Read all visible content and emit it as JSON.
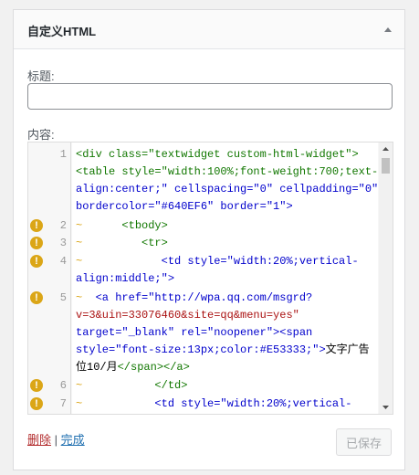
{
  "widget": {
    "title": "自定义HTML",
    "toggle_icon": "arrow-up-icon"
  },
  "form": {
    "title_label": "标题:",
    "title_value": "",
    "content_label": "内容:"
  },
  "editor": {
    "lines": [
      {
        "num": "1",
        "warn": false
      },
      {
        "num": "",
        "warn": false
      },
      {
        "num": "",
        "warn": false
      },
      {
        "num": "2",
        "warn": true
      },
      {
        "num": "3",
        "warn": true
      },
      {
        "num": "4",
        "warn": true
      },
      {
        "num": "",
        "warn": false
      },
      {
        "num": "5",
        "warn": true
      },
      {
        "num": "",
        "warn": false
      },
      {
        "num": "",
        "warn": false
      },
      {
        "num": "",
        "warn": false
      },
      {
        "num": "",
        "warn": false
      },
      {
        "num": "6",
        "warn": true
      },
      {
        "num": "7",
        "warn": true
      }
    ],
    "code": {
      "l1": "<div class=\"textwidget custom-html-widget\">",
      "l2": "<table style=\"width:100%;font-weight:700;text-",
      "l3": "align:center;\" cellspacing=\"0\" cellpadding=\"0\"",
      "l4": "bordercolor=\"#640EF6\" border=\"1\">",
      "l5": "<tbody>",
      "l6": "<tr>",
      "l7": "<td style=\"width:20%;vertical-",
      "l8": "align:middle;\">",
      "l9": "<a href=\"http://wpa.qq.com/msgrd?",
      "l10": "v=3&uin=33076460&site=qq&menu=yes\"",
      "l11": "target=\"_blank\" rel=\"noopener\"><span",
      "l12": "style=\"font-size:13px;color:#E53333;\">",
      "l12b": "文字广告",
      "l13": "位10/月",
      "l13b": "</span></a>",
      "l14": "</td>",
      "l15": "<td style=\"width:20%;vertical-"
    },
    "warning_symbol": "!",
    "indent_symbol": "~"
  },
  "footer": {
    "delete_label": "删除",
    "separator": "|",
    "done_label": "完成",
    "save_label": "已保存"
  }
}
